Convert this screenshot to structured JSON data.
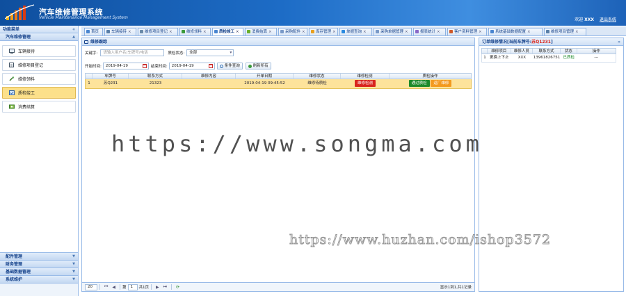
{
  "header": {
    "title": "汽车维修管理系统",
    "subtitle": "Vehicle Maintenance Management System",
    "welcome": "欢迎",
    "user": "XXX",
    "logout": "退出系统"
  },
  "sidebar": {
    "title": "功能菜单",
    "group_title": "汽车维修管理",
    "items": [
      {
        "label": "车辆接待",
        "icon": "car-reception-icon"
      },
      {
        "label": "维修项目登记",
        "icon": "repair-register-icon"
      },
      {
        "label": "维修领料",
        "icon": "material-pick-icon"
      },
      {
        "label": "质检竣工",
        "icon": "quality-check-icon"
      },
      {
        "label": "消费结算",
        "icon": "settlement-icon"
      }
    ],
    "active_index": 3,
    "bottom_groups": [
      "配件管理",
      "财务管理",
      "基础数据管理",
      "系统维护"
    ]
  },
  "tabs": [
    {
      "label": "首页",
      "closable": false
    },
    {
      "label": "车辆接待",
      "closable": true
    },
    {
      "label": "维修项目登记",
      "closable": true
    },
    {
      "label": "维修领料",
      "closable": true
    },
    {
      "label": "质检竣工",
      "closable": true,
      "active": true
    },
    {
      "label": "消费结算",
      "closable": true
    },
    {
      "label": "采购配件",
      "closable": true
    },
    {
      "label": "库存管理",
      "closable": true
    },
    {
      "label": "单据查询",
      "closable": true
    },
    {
      "label": "采购单据管理",
      "closable": true
    },
    {
      "label": "报表统计",
      "closable": true
    },
    {
      "label": "客户资料管理",
      "closable": true
    },
    {
      "label": "系统基础数据配置",
      "closable": true
    },
    {
      "label": "维修项目管理",
      "closable": true
    }
  ],
  "main": {
    "panel_title": "维修跟踪",
    "keyword_label": "关键字:",
    "keyword_placeholder": "请输入用户名/车牌号/电话",
    "qc_status_label": "质检状态:",
    "qc_status_value": "全部",
    "start_label": "开始时间:",
    "start_value": "2019-04-19",
    "end_label": "结束时间:",
    "end_value": "2019-04-19",
    "search_btn": "条件查询",
    "refresh_btn": "刷新所有",
    "columns": [
      "",
      "车牌号",
      "联系方式",
      "维修内容",
      "开单日期",
      "维修状态",
      "维修检测",
      "质检操作"
    ],
    "rows": [
      {
        "idx": "1",
        "plate": "苏Q231",
        "contact": "21323",
        "content": "",
        "date": "2019-04-19 09:45:52",
        "status": "维修待质检",
        "check_btn": "维修检测",
        "pass_btn": "通过质检",
        "redo_btn": "返厂维修"
      }
    ],
    "pager": {
      "page_size": "20",
      "page_prefix": "第",
      "page_value": "1",
      "page_suffix": "共1页",
      "info": "显示1到1,共1记录"
    }
  },
  "right": {
    "title_prefix": "订单维修情况[当前车牌号:",
    "plate": "苏Q1231",
    "title_suffix": "]",
    "columns": [
      "",
      "维修项目",
      "维修人员",
      "联系方式",
      "状态",
      "操作"
    ],
    "rows": [
      {
        "idx": "1",
        "item": "更换上下止",
        "staff": "XXX",
        "phone": "13961826751",
        "status": "已质检",
        "op": "---"
      }
    ]
  },
  "watermarks": {
    "main": "https://www.songma.com",
    "secondary": "https://www.huzhan.com/ishop3572"
  },
  "colors": {
    "header": "#1d6cc6",
    "highlight_row": "#fde39b",
    "red": "#d9251d",
    "green": "#1d8a2a",
    "orange": "#f39a1e"
  }
}
